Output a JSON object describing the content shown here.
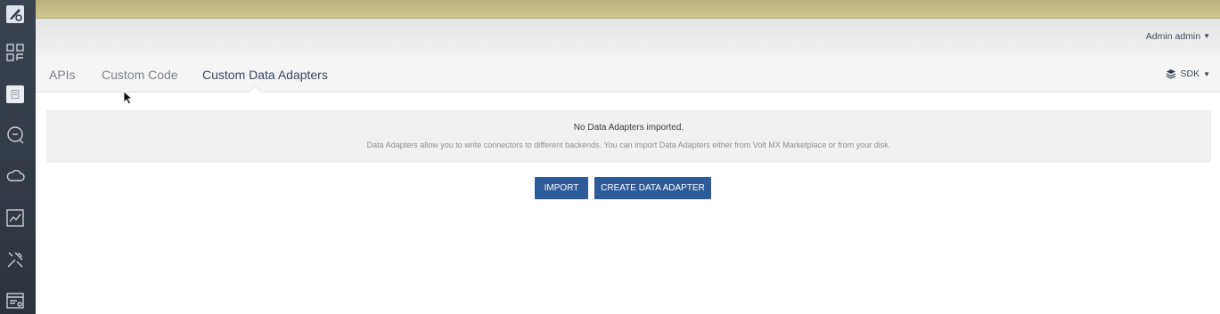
{
  "rail": {
    "icons": [
      "logo-icon",
      "apps-icon",
      "document-icon",
      "search-chat-icon",
      "cloud-icon",
      "analytics-icon",
      "tools-icon",
      "settings-card-icon"
    ]
  },
  "header": {
    "user_label": "Admin admin"
  },
  "tabs": [
    {
      "label": "APIs"
    },
    {
      "label": "Custom Code"
    },
    {
      "label": "Custom Data Adapters"
    }
  ],
  "sdk_label": "SDK",
  "empty_state": {
    "title": "No Data Adapters imported.",
    "description": "Data Adapters allow you to write connectors to different backends. You can import Data Adapters either from Volt MX Marketplace or from your disk."
  },
  "buttons": {
    "import": "IMPORT",
    "create": "CREATE DATA ADAPTER"
  },
  "colors": {
    "primary": "#2d5b9a",
    "rail": "#2f3640",
    "topbar": "#c4bc86"
  }
}
